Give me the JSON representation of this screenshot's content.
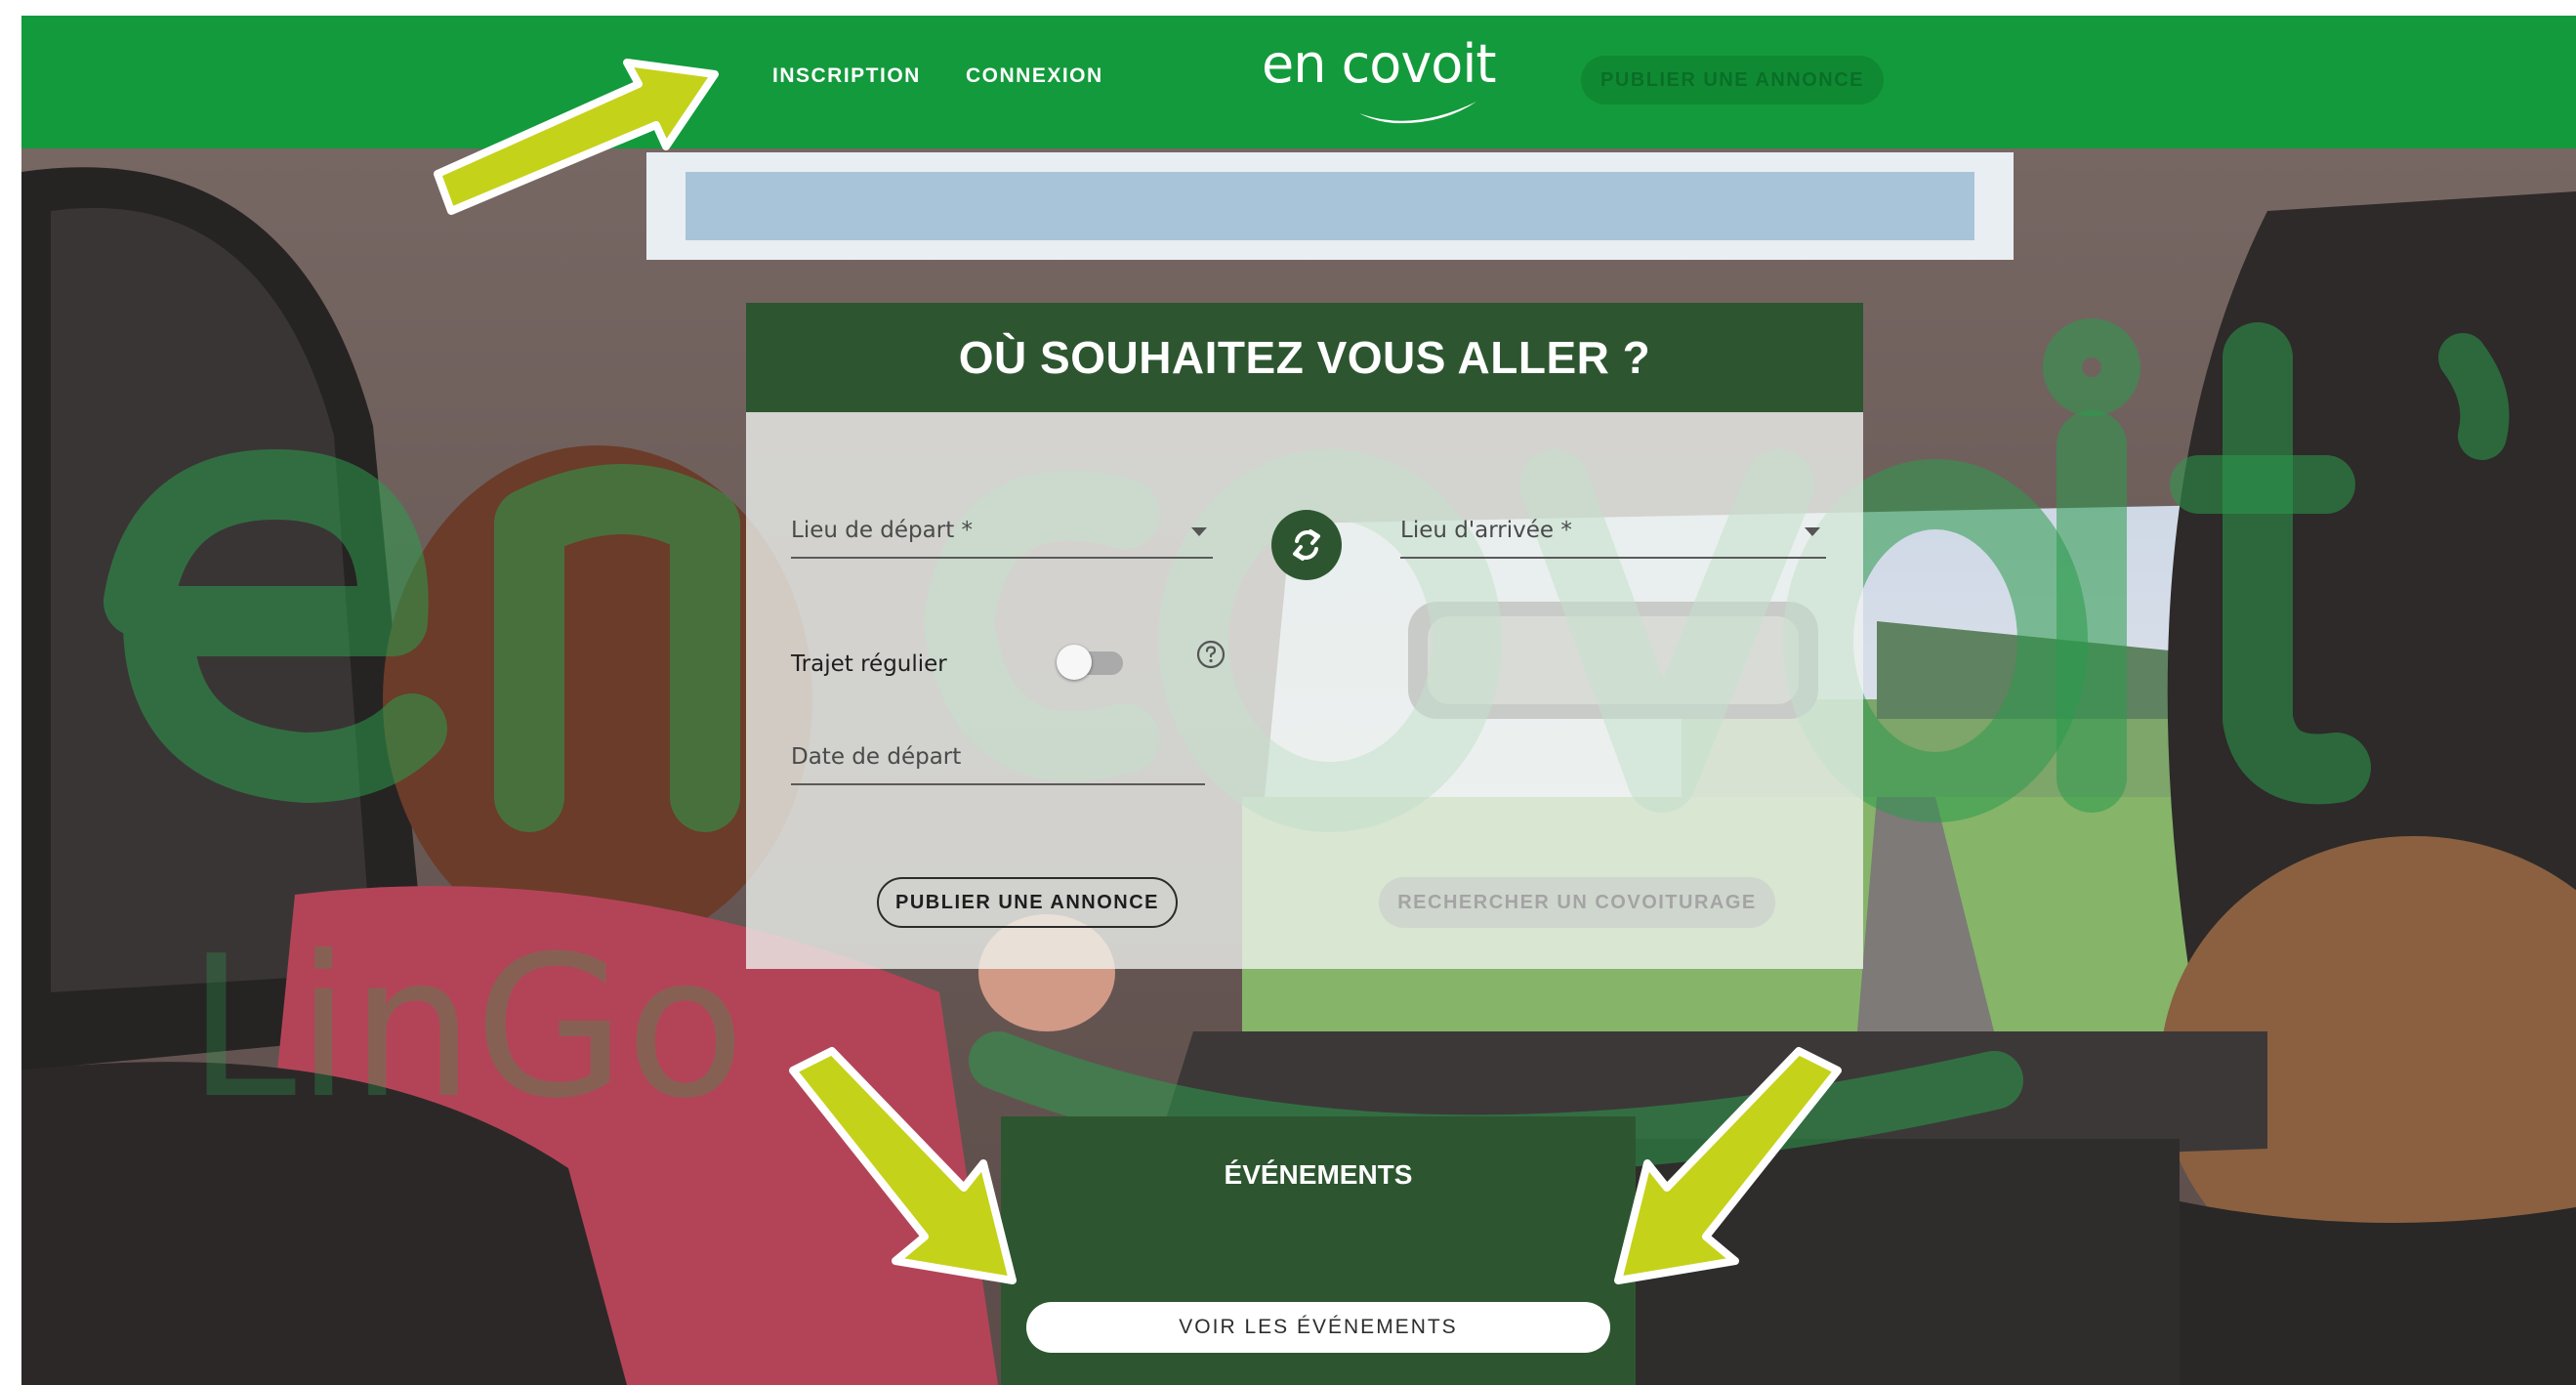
{
  "navbar": {
    "inscription_label": "INSCRIPTION",
    "connexion_label": "CONNEXION",
    "logo_text": "en covoit",
    "publish_label": "PUBLIER UNE ANNONCE"
  },
  "watermark": {
    "big_text": "en covoit",
    "brand_text": "LinGo"
  },
  "search": {
    "title": "OÙ SOUHAITEZ VOUS ALLER ?",
    "departure_label": "Lieu de départ *",
    "arrival_label": "Lieu d'arrivée *",
    "regular_trip_label": "Trajet régulier",
    "regular_trip_on": false,
    "date_label": "Date de départ",
    "publish_button": "PUBLIER UNE ANNONCE",
    "search_button": "RECHERCHER UN COVOITURAGE"
  },
  "events": {
    "title": "ÉVÉNEMENTS",
    "button_label": "VOIR LES ÉVÉNEMENTS"
  },
  "colors": {
    "brand_green": "#139a3c",
    "dark_green": "#2d5630",
    "annotation_arrow": "#c5d21a"
  }
}
